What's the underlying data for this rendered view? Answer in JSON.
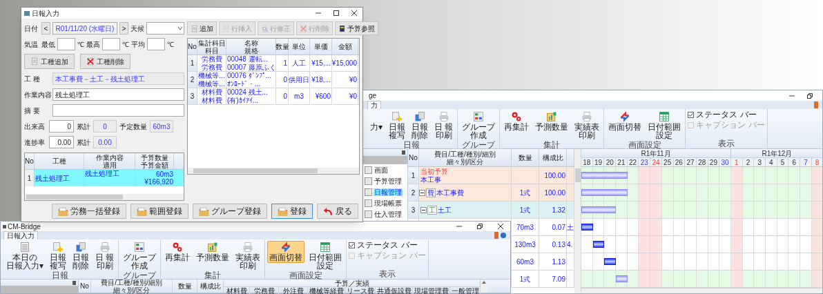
{
  "dialog": {
    "title": "日報入力",
    "date": {
      "label": "日付",
      "prev": "<",
      "value": "R01/11/20 (水曜日)",
      "next": ">"
    },
    "weather": {
      "label": "天候"
    },
    "temperature": {
      "label": "気温",
      "fields": [
        {
          "label": "最低",
          "unit": "℃"
        },
        {
          "label": "最高",
          "unit": "℃"
        },
        {
          "label": "平均",
          "unit": "℃"
        }
      ]
    },
    "work_type_buttons": [
      {
        "label": "工種追加"
      },
      {
        "label": "工種削除"
      }
    ],
    "work_type": {
      "label": "工 種",
      "value": "本工事費－土工－残土処理工"
    },
    "work_content": {
      "label": "作業内容",
      "value": "残土処理工"
    },
    "remarks": {
      "label": "摘 要"
    },
    "output": {
      "label": "出来高",
      "value": "0",
      "total_label": "累計",
      "total": "0",
      "planned_label": "予定数量",
      "planned": "60m3"
    },
    "progress": {
      "label": "進捗率",
      "value": "0.00",
      "total_label": "累計",
      "total": "0.00"
    },
    "work_table": {
      "columns": [
        [
          "No"
        ],
        [
          "工種"
        ],
        [
          "作業内容",
          "適用"
        ],
        [
          "予算数量",
          "予算金額"
        ]
      ],
      "rows": [
        {
          "no": "1",
          "work_type": "残土処理工",
          "content": "残土処理工",
          "quantity": "60m3",
          "amount": "¥166,920",
          "selected": true
        }
      ]
    },
    "toolbar": [
      {
        "label": "追加",
        "disabled": false
      },
      {
        "label": "行挿入",
        "disabled": true
      },
      {
        "label": "行修正",
        "disabled": true
      },
      {
        "label": "行削除",
        "disabled": true
      },
      {
        "label": "予算参照",
        "disabled": false
      }
    ],
    "detail_table": {
      "columns": [
        [
          "No"
        ],
        [
          "集計科目",
          "科目"
        ],
        [
          "名称",
          "規格"
        ],
        [
          "数量"
        ],
        [
          "単位"
        ],
        [
          "単価"
        ],
        [
          "金額"
        ]
      ],
      "rows": [
        {
          "no": "1",
          "account": [
            "労務費",
            "労務費"
          ],
          "name": [
            "00048 運転...",
            "00007 藤原ふく"
          ],
          "quantity": "1",
          "unit": "人工",
          "price": "¥15,...",
          "amount": "¥15,000"
        },
        {
          "no": "2",
          "account": [
            "機械等...",
            "機械等..."
          ],
          "name": [
            "00076 ﾀﾞﾝﾌﾟ...",
            "ｵﾝﾛｰﾄﾞ・..."
          ],
          "quantity": "0",
          "unit": "供用日",
          "price": "¥18,...",
          "amount": "¥0"
        },
        {
          "no": "3",
          "account": [
            "材料費",
            "材料費"
          ],
          "name": [
            "00024 残土...",
            "(有)ｶｲｱｲ..."
          ],
          "quantity": "0",
          "unit": "m3",
          "price": "¥600",
          "amount": "¥0"
        }
      ]
    },
    "buttons": [
      {
        "label": "労務一括登録",
        "focused": false
      },
      {
        "label": "範囲登録",
        "focused": false
      },
      {
        "label": "グループ登録",
        "focused": false
      },
      {
        "label": "登録",
        "focused": true
      },
      {
        "label": "戻る",
        "focused": false
      }
    ]
  },
  "back_window": {
    "title": "ge",
    "tab": {
      "label": "力",
      "selected": true
    },
    "ribbon": {
      "groups": [
        {
          "label": "日報",
          "buttons": [
            {
              "label": [
                "力▾"
              ],
              "pressed": false
            },
            {
              "label": [
                "日報",
                "複写"
              ],
              "pressed": false
            },
            {
              "label": [
                "日報",
                "削除"
              ],
              "pressed": false
            },
            {
              "label": [
                "日 報",
                "印刷"
              ],
              "pressed": false
            }
          ]
        },
        {
          "label": "グループ",
          "buttons": [
            {
              "label": [
                "グループ",
                "作成"
              ],
              "pressed": false
            }
          ]
        },
        {
          "label": "集計",
          "buttons": [
            {
              "label": [
                "再集計"
              ],
              "pressed": false
            },
            {
              "label": [
                "予測数量"
              ],
              "pressed": false
            },
            {
              "label": [
                "実績表",
                "印刷"
              ],
              "pressed": false
            }
          ]
        },
        {
          "label": "画面設定",
          "buttons": [
            {
              "label": [
                "画面切替"
              ],
              "pressed": false
            },
            {
              "label": [
                "日付範囲",
                "設定"
              ],
              "pressed": false
            }
          ]
        },
        {
          "label": "表示",
          "checks": [
            {
              "label": "ステータス バー",
              "checked": true,
              "disabled": false
            },
            {
              "label": "キャプション バー",
              "checked": false,
              "disabled": true
            }
          ]
        }
      ]
    },
    "nav": [
      {
        "label": "画面",
        "selected": false
      },
      {
        "label": "予算管理",
        "selected": false
      },
      {
        "label": "日報管理",
        "selected": true
      },
      {
        "label": "現場帳票",
        "selected": false
      },
      {
        "label": "仕入管理",
        "selected": false
      }
    ],
    "grid": {
      "columns": [
        [
          "No"
        ],
        [
          "費目/工種/種別/細別",
          "細々別/区分"
        ],
        [
          "数量"
        ],
        [
          "構成比"
        ]
      ],
      "rows": [
        {
          "kind": "budget",
          "no": "1",
          "title": "当初予算",
          "name": "本工事",
          "ratio": "100.00",
          "color": "#fde8dc"
        },
        {
          "kind": "cost",
          "no": "2",
          "tag": "費",
          "name": "本工事費",
          "quantity": "1式",
          "ratio": "100.00",
          "expanded": true,
          "color": "#fde8dc",
          "children": [
            {
              "kind": "work",
              "no": "3",
              "tag": "工",
              "name": "土工",
              "quantity": "1式",
              "ratio": "1.32",
              "expanded": true,
              "color": "#dcf3f6",
              "children": [
                {
                  "kind": "covered",
                  "quantity": "70m3",
                  "ratio": "0.07",
                  "column_5": "土",
                  "color": "#ffffff"
                },
                {
                  "kind": "covered",
                  "quantity": "130m3",
                  "ratio": "0.13",
                  "column_5": "4.",
                  "color": "#ffffff"
                },
                {
                  "kind": "covered",
                  "quantity": "60m3",
                  "ratio": "1.13",
                  "color": "#ffffff"
                },
                {
                  "kind": "covered",
                  "quantity": "1式",
                  "ratio": "7.09",
                  "color": "#ffffff"
                }
              ]
            }
          ]
        }
      ]
    },
    "gantt": {
      "months": [
        {
          "label": "R1年11月",
          "days": [
            {
              "label": "18",
              "kind": "weekday",
              "rest": false
            },
            {
              "label": "19",
              "kind": "weekday",
              "rest": false
            },
            {
              "label": "20",
              "kind": "weekday",
              "rest": false
            },
            {
              "label": "21",
              "kind": "weekday",
              "rest": false
            },
            {
              "label": "22",
              "kind": "weekday",
              "rest": false
            },
            {
              "label": "23",
              "kind": "saturday",
              "rest": true
            },
            {
              "label": "24",
              "kind": "sunday",
              "rest": true
            },
            {
              "label": "25",
              "kind": "weekday",
              "rest": false
            },
            {
              "label": "26",
              "kind": "weekday",
              "rest": false
            },
            {
              "label": "27",
              "kind": "weekday",
              "rest": false
            },
            {
              "label": "28",
              "kind": "weekday",
              "rest": false
            },
            {
              "label": "29",
              "kind": "weekday",
              "rest": false
            },
            {
              "label": "30",
              "kind": "saturday",
              "rest": false
            }
          ]
        },
        {
          "label": "R1年12月",
          "days": [
            {
              "label": "1",
              "kind": "sunday",
              "rest": true
            },
            {
              "label": "2",
              "kind": "weekday",
              "rest": false
            },
            {
              "label": "3",
              "kind": "weekday",
              "rest": false
            },
            {
              "label": "4",
              "kind": "weekday",
              "rest": false
            },
            {
              "label": "5",
              "kind": "weekday",
              "rest": false
            },
            {
              "label": "6",
              "kind": "weekday",
              "rest": false
            },
            {
              "label": "7",
              "kind": "saturday",
              "rest": false
            },
            {
              "label": "8",
              "kind": "sunday",
              "rest": true
            }
          ]
        }
      ]
    }
  },
  "front_window": {
    "title": "CM-Bridge",
    "tab": {
      "label": "日報入力",
      "selected": true
    },
    "ribbon": {
      "groups": [
        {
          "label": "日報",
          "buttons": [
            {
              "label": [
                "本日の",
                "日報入力▾"
              ],
              "pressed": false
            },
            {
              "label": [
                "日報",
                "複写"
              ],
              "pressed": false
            },
            {
              "label": [
                "日報",
                "削除"
              ],
              "pressed": false
            },
            {
              "label": [
                "日 報",
                "印刷"
              ],
              "pressed": false
            }
          ]
        },
        {
          "label": "グループ",
          "buttons": [
            {
              "label": [
                "グループ",
                "作成"
              ],
              "pressed": false
            }
          ]
        },
        {
          "label": "集計",
          "buttons": [
            {
              "label": [
                "再集計"
              ],
              "pressed": false
            },
            {
              "label": [
                "予測数量"
              ],
              "pressed": false
            },
            {
              "label": [
                "実績表",
                "印刷"
              ],
              "pressed": false
            }
          ]
        },
        {
          "label": "画面設定",
          "buttons": [
            {
              "label": [
                "画面切替"
              ],
              "pressed": true
            },
            {
              "label": [
                "日付範囲",
                "設定"
              ],
              "pressed": false
            }
          ]
        },
        {
          "label": "表示",
          "checks": [
            {
              "label": "ステータス バー",
              "checked": true,
              "disabled": false
            },
            {
              "label": "キャプション バー",
              "checked": false,
              "disabled": true
            }
          ]
        }
      ]
    },
    "grid": {
      "columns": [
        [
          "No"
        ],
        [
          "費目/工種/種別/細別",
          "細々別/区分"
        ],
        [
          "数量"
        ],
        [
          "構成比"
        ]
      ],
      "group_header": "予算／実績",
      "cost_columns": [
        "材料費",
        "労務費",
        "外注費",
        "機械等経費",
        "リース費",
        "共通仮設費",
        "現場管理費",
        "一般管理"
      ]
    }
  }
}
